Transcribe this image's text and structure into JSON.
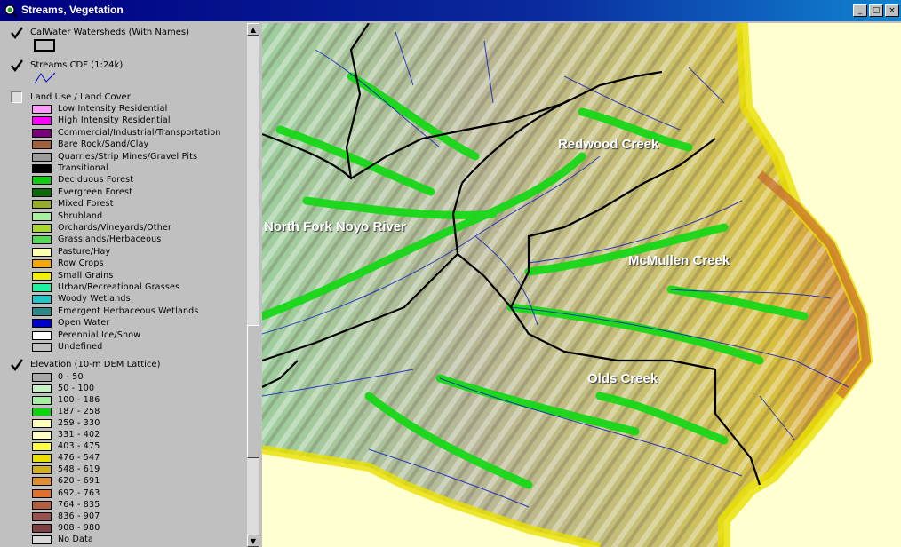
{
  "window": {
    "title": "Streams, Vegetation",
    "min_glyph": "_",
    "max_glyph": "□",
    "close_glyph": "×"
  },
  "toc": {
    "layers": [
      {
        "name": "CalWater Watersheds (With Names)",
        "checked": true,
        "icon": "polygon-outline-swatch"
      },
      {
        "name": "Streams CDF (1:24k)",
        "checked": true,
        "icon": "stream-line-swatch"
      },
      {
        "name": "Land Use / Land Cover",
        "checked": false
      },
      {
        "name": "Elevation (10-m DEM Lattice)",
        "checked": true
      }
    ],
    "landuse_classes": [
      {
        "label": "Low Intensity Residential",
        "color": "#ff9bff"
      },
      {
        "label": "High Intensity Residential",
        "color": "#ff00ff"
      },
      {
        "label": "Commercial/Industrial/Transportation",
        "color": "#7a007a"
      },
      {
        "label": "Bare Rock/Sand/Clay",
        "color": "#a0623a"
      },
      {
        "label": "Quarries/Strip Mines/Gravel Pits",
        "color": "#9c9c9c"
      },
      {
        "label": "Transitional",
        "color": "#000000"
      },
      {
        "label": "Deciduous Forest",
        "color": "#10cc10"
      },
      {
        "label": "Evergreen Forest",
        "color": "#0a6a0a"
      },
      {
        "label": "Mixed Forest",
        "color": "#9aab2a"
      },
      {
        "label": "Shrubland",
        "color": "#a8f0a0"
      },
      {
        "label": "Orchards/Vineyards/Other",
        "color": "#a8d830"
      },
      {
        "label": "Grasslands/Herbaceous",
        "color": "#55d855"
      },
      {
        "label": "Pasture/Hay",
        "color": "#ffffb0"
      },
      {
        "label": "Row Crops",
        "color": "#f2a800"
      },
      {
        "label": "Small Grains",
        "color": "#f0f000"
      },
      {
        "label": "Urban/Recreational Grasses",
        "color": "#20f0a0"
      },
      {
        "label": "Woody Wetlands",
        "color": "#20c8c8"
      },
      {
        "label": "Emergent Herbaceous Wetlands",
        "color": "#2a8a8a"
      },
      {
        "label": "Open Water",
        "color": "#0000c8"
      },
      {
        "label": "Perennial Ice/Snow",
        "color": "#ffffff"
      },
      {
        "label": "Undefined",
        "color": "#c0c0c0"
      }
    ],
    "elevation_classes": [
      {
        "label": "0 - 50",
        "color": "#a8a8a8"
      },
      {
        "label": "50 - 100",
        "color": "#c8f0c8"
      },
      {
        "label": "100 - 186",
        "color": "#a0f0a0"
      },
      {
        "label": "187 - 258",
        "color": "#10d010"
      },
      {
        "label": "259 - 330",
        "color": "#ffffb8"
      },
      {
        "label": "331 - 402",
        "color": "#ffffc8"
      },
      {
        "label": "403 - 475",
        "color": "#ffff40"
      },
      {
        "label": "476 - 547",
        "color": "#e8e000"
      },
      {
        "label": "548 - 619",
        "color": "#d0b020"
      },
      {
        "label": "620 - 691",
        "color": "#e09030"
      },
      {
        "label": "692 - 763",
        "color": "#e07030"
      },
      {
        "label": "764 - 835",
        "color": "#b06040"
      },
      {
        "label": "836 - 907",
        "color": "#985050"
      },
      {
        "label": "908 - 980",
        "color": "#804040"
      },
      {
        "label": "No Data",
        "color": "#d8d8d8"
      }
    ]
  },
  "map": {
    "labels": [
      "Redwood Creek",
      "North Fork Noyo River",
      "McMullen Creek",
      "Olds Creek"
    ]
  }
}
